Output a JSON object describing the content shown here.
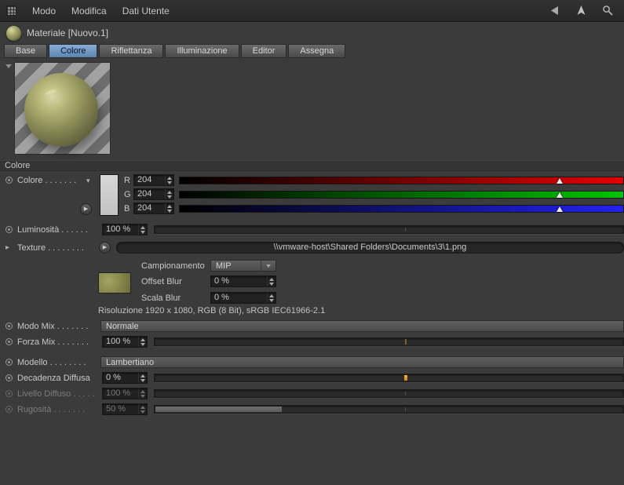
{
  "menu": {
    "items": [
      "Modo",
      "Modifica",
      "Dati Utente"
    ]
  },
  "material": {
    "title": "Materiale [Nuovo.1]"
  },
  "tabs": [
    {
      "label": "Base",
      "selected": false
    },
    {
      "label": "Colore",
      "selected": true
    },
    {
      "label": "Riflettanza",
      "selected": false
    },
    {
      "label": "Illuminazione",
      "selected": false
    },
    {
      "label": "Editor",
      "selected": false
    },
    {
      "label": "Assegna",
      "selected": false
    }
  ],
  "section_header": "Colore",
  "icons": {
    "caret_down": "▾",
    "caret_right": "▸",
    "play": "▶"
  },
  "params": {
    "colore": {
      "label": "Colore . . . . . . .",
      "channels": [
        {
          "name": "R",
          "value": "204"
        },
        {
          "name": "G",
          "value": "204"
        },
        {
          "name": "B",
          "value": "204"
        }
      ]
    },
    "luminosita": {
      "label": "Luminosità . . . . . .",
      "value": "100 %"
    },
    "texture": {
      "label": "Texture . . . . . . . .",
      "path": "\\\\vmware-host\\Shared Folders\\Documents\\3\\1.png"
    },
    "campionamento": {
      "label": "Campionamento",
      "value": "MIP"
    },
    "offset_blur": {
      "label": "Offset Blur",
      "value": "0 %"
    },
    "scala_blur": {
      "label": "Scala Blur",
      "value": "0 %"
    },
    "risoluzione": "Risoluzione 1920 x 1080, RGB (8 Bit), sRGB IEC61966-2.1",
    "modo_mix": {
      "label": "Modo Mix . . . . . . .",
      "value": "Normale"
    },
    "forza_mix": {
      "label": "Forza Mix . . . . . . .",
      "value": "100 %"
    },
    "modello": {
      "label": "Modello . . . . . . . .",
      "value": "Lambertiano"
    },
    "decadenza_diffusa": {
      "label": "Decadenza Diffusa",
      "value": "0 %"
    },
    "livello_diffuso": {
      "label": "Livello Diffuso . . . . .",
      "value": "100 %",
      "disabled": true
    },
    "rugosita": {
      "label": "Rugosità . . . . . . .",
      "value": "50 %",
      "disabled": true
    }
  },
  "colors": {
    "tab_selected_blue": "#6f95c1",
    "slider_marker_orange": "#e6930f",
    "material_olive": "#8f8f58",
    "channel_red": "#e40000",
    "channel_green": "#00c400",
    "channel_blue": "#2222f0"
  }
}
